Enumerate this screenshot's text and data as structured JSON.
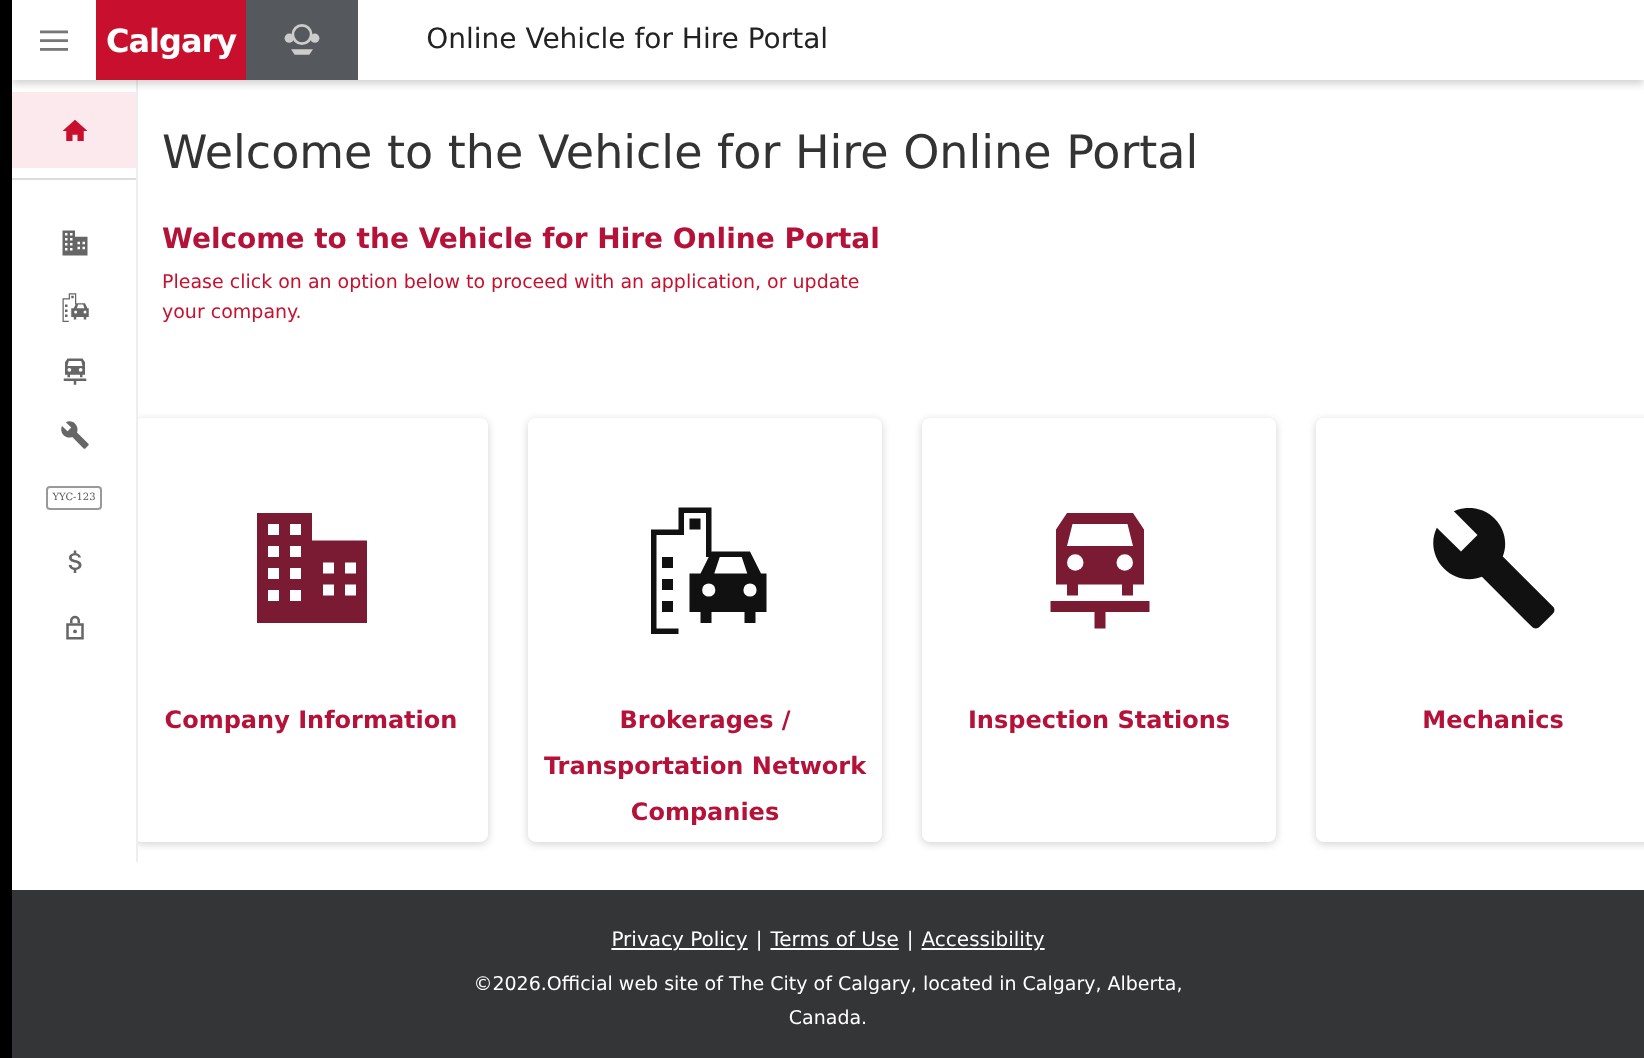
{
  "header": {
    "logo_text": "Calgary",
    "title": "Online Vehicle for Hire Portal"
  },
  "sidebar": {
    "items": [
      {
        "kind": "home",
        "selected": true
      },
      {
        "kind": "company",
        "selected": false
      },
      {
        "kind": "brokerage",
        "selected": false
      },
      {
        "kind": "inspection",
        "selected": false
      },
      {
        "kind": "mechanic",
        "selected": false
      },
      {
        "kind": "plate",
        "label": "YYC-123",
        "selected": false
      },
      {
        "kind": "dollar",
        "selected": false
      },
      {
        "kind": "lock",
        "selected": false
      }
    ]
  },
  "page_title": "Welcome to the Vehicle for Hire Online Portal",
  "intro": {
    "heading": "Welcome to the Vehicle for Hire Online Portal",
    "text": "Please click on an option below to proceed with an application, or update your company."
  },
  "cards": [
    {
      "kind": "company",
      "label": "Company Information",
      "color": "#7b1a33"
    },
    {
      "kind": "brokerage",
      "label": "Brokerages / Transportation Network Companies",
      "color": "#111111"
    },
    {
      "kind": "inspection",
      "label": "Inspection Stations",
      "color": "#7b1a33"
    },
    {
      "kind": "mechanic",
      "label": "Mechanics",
      "color": "#111111"
    }
  ],
  "footer": {
    "links": [
      "Privacy Policy",
      "Terms of Use",
      "Accessibility"
    ],
    "separators": [
      "|",
      "|"
    ],
    "text": "©2026.Official web site of The City of Calgary, located in Calgary, Alberta, Canada."
  }
}
